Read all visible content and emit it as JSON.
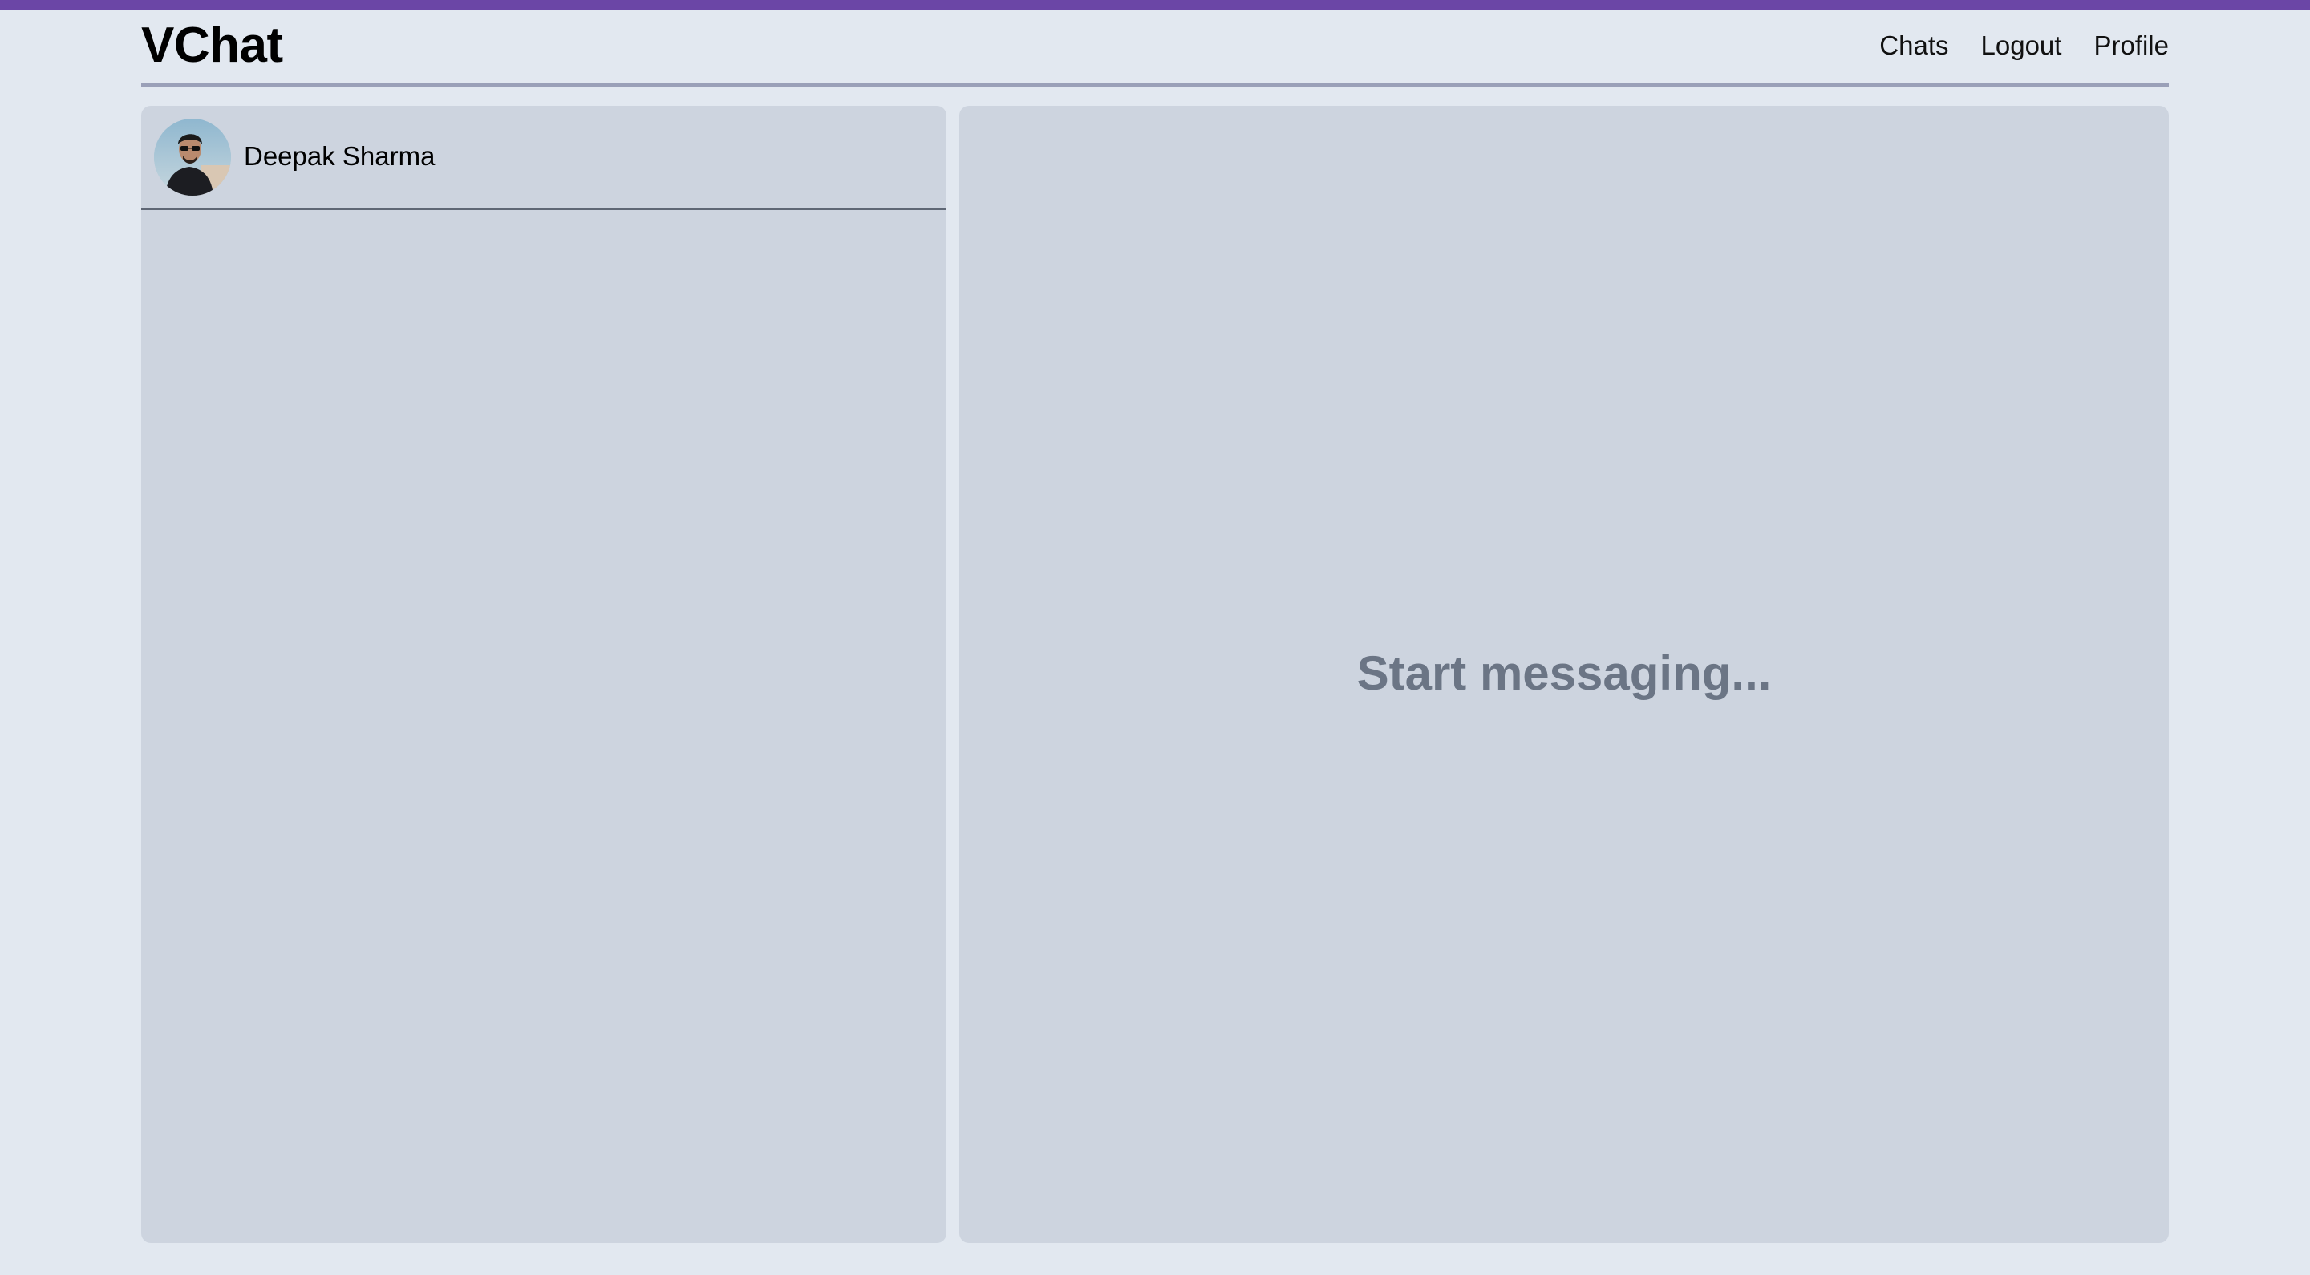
{
  "app": {
    "brand": "VChat",
    "accent_color": "#6b46a6"
  },
  "nav": {
    "items": [
      {
        "label": "Chats"
      },
      {
        "label": "Logout"
      },
      {
        "label": "Profile"
      }
    ]
  },
  "sidebar": {
    "chats": [
      {
        "name": "Deepak Sharma",
        "avatar_icon": "user-photo"
      }
    ]
  },
  "main": {
    "placeholder": "Start messaging..."
  }
}
